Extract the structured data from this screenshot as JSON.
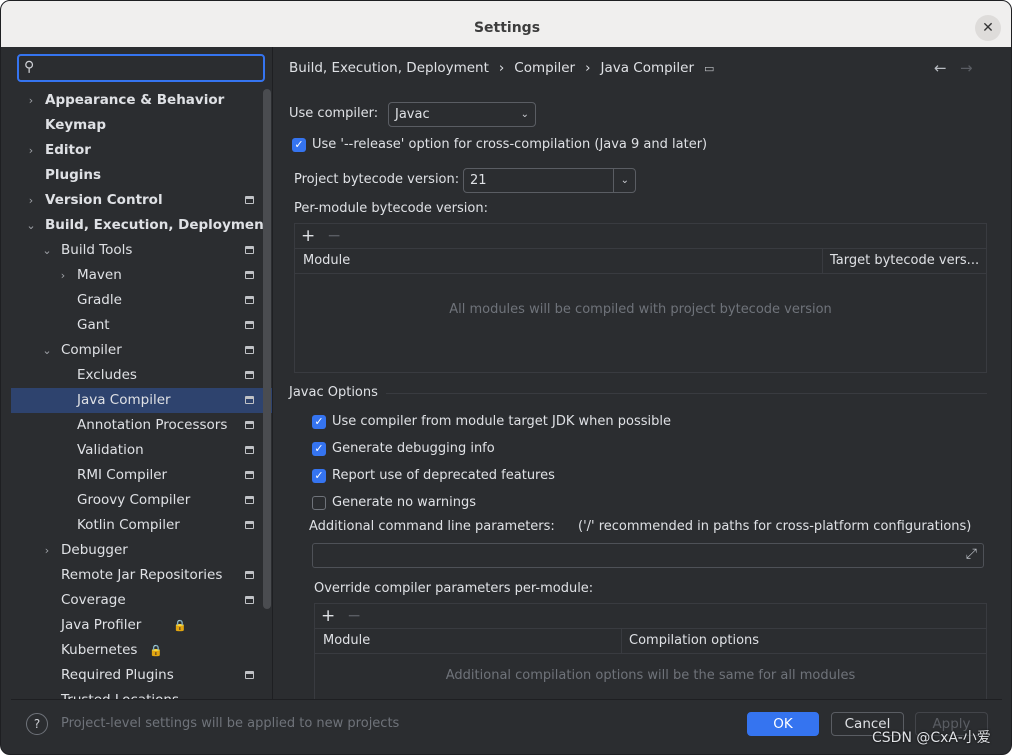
{
  "window": {
    "title": "Settings",
    "close_glyph": "✕"
  },
  "sidebar": {
    "search_placeholder": "",
    "items": [
      {
        "label": "Appearance & Behavior",
        "level": 0,
        "chevron": "›",
        "bold": true
      },
      {
        "label": "Keymap",
        "level": 0,
        "chevron": "",
        "bold": true
      },
      {
        "label": "Editor",
        "level": 0,
        "chevron": "›",
        "bold": true
      },
      {
        "label": "Plugins",
        "level": 0,
        "chevron": "",
        "bold": true
      },
      {
        "label": "Version Control",
        "level": 0,
        "chevron": "›",
        "bold": true,
        "project": true
      },
      {
        "label": "Build, Execution, Deployment",
        "level": 0,
        "chevron": "⌄",
        "bold": true
      },
      {
        "label": "Build Tools",
        "level": 1,
        "chevron": "⌄",
        "project": true
      },
      {
        "label": "Maven",
        "level": 2,
        "chevron": "›",
        "project": true
      },
      {
        "label": "Gradle",
        "level": 2,
        "chevron": "",
        "project": true
      },
      {
        "label": "Gant",
        "level": 2,
        "chevron": "",
        "project": true
      },
      {
        "label": "Compiler",
        "level": 1,
        "chevron": "⌄",
        "project": true
      },
      {
        "label": "Excludes",
        "level": 2,
        "chevron": "",
        "project": true
      },
      {
        "label": "Java Compiler",
        "level": 2,
        "chevron": "",
        "project": true,
        "selected": true
      },
      {
        "label": "Annotation Processors",
        "level": 2,
        "chevron": "",
        "project": true
      },
      {
        "label": "Validation",
        "level": 2,
        "chevron": "",
        "project": true
      },
      {
        "label": "RMI Compiler",
        "level": 2,
        "chevron": "",
        "project": true
      },
      {
        "label": "Groovy Compiler",
        "level": 2,
        "chevron": "",
        "project": true
      },
      {
        "label": "Kotlin Compiler",
        "level": 2,
        "chevron": "",
        "project": true
      },
      {
        "label": "Debugger",
        "level": 1,
        "chevron": "›"
      },
      {
        "label": "Remote Jar Repositories",
        "level": 1,
        "chevron": "",
        "project": true
      },
      {
        "label": "Coverage",
        "level": 1,
        "chevron": "",
        "project": true
      },
      {
        "label": "Java Profiler",
        "level": 1,
        "chevron": "",
        "lock": true
      },
      {
        "label": "Kubernetes",
        "level": 1,
        "chevron": "",
        "lock": true
      },
      {
        "label": "Required Plugins",
        "level": 1,
        "chevron": "",
        "project": true
      },
      {
        "label": "Trusted Locations",
        "level": 1,
        "chevron": ""
      }
    ]
  },
  "content": {
    "breadcrumb": [
      "Build, Execution, Deployment",
      "›",
      "Compiler",
      "›",
      "Java Compiler"
    ],
    "nav_back": "←",
    "nav_forward": "→",
    "use_compiler_label": "Use compiler:",
    "use_compiler_value": "Javac",
    "release_option_label": "Use '--release' option for cross-compilation (Java 9 and later)",
    "release_option_checked": true,
    "bytecode_label": "Project bytecode version:",
    "bytecode_value": "21",
    "per_module_label": "Per-module bytecode version:",
    "per_module_table": {
      "add_glyph": "+",
      "remove_glyph": "−",
      "columns": [
        "Module",
        "Target bytecode vers..."
      ],
      "empty_text": "All modules will be compiled with project bytecode version"
    },
    "javac_options_title": "Javac Options",
    "javac_options": [
      {
        "label": "Use compiler from module target JDK when possible",
        "checked": true
      },
      {
        "label": "Generate debugging info",
        "checked": true
      },
      {
        "label": "Report use of deprecated features",
        "checked": true
      },
      {
        "label": "Generate no warnings",
        "checked": false
      }
    ],
    "additional_params_label": "Additional command line parameters:",
    "additional_params_hint": "('/' recommended in paths for cross-platform configurations)",
    "additional_params_value": "",
    "expand_glyph": "⤢",
    "override_label": "Override compiler parameters per-module:",
    "override_table": {
      "add_glyph": "+",
      "remove_glyph": "−",
      "columns": [
        "Module",
        "Compilation options"
      ],
      "empty_text": "Additional compilation options will be the same for all modules"
    }
  },
  "footer": {
    "help_glyph": "?",
    "note": "Project-level settings will be applied to new projects",
    "ok_label": "OK",
    "cancel_label": "Cancel",
    "apply_label": "Apply"
  },
  "watermark": "CSDN @CxA-小爱",
  "colors": {
    "accent": "#3574f0",
    "selection": "#2e436e",
    "background": "#2b2d30",
    "lock": "#c77dbb"
  }
}
